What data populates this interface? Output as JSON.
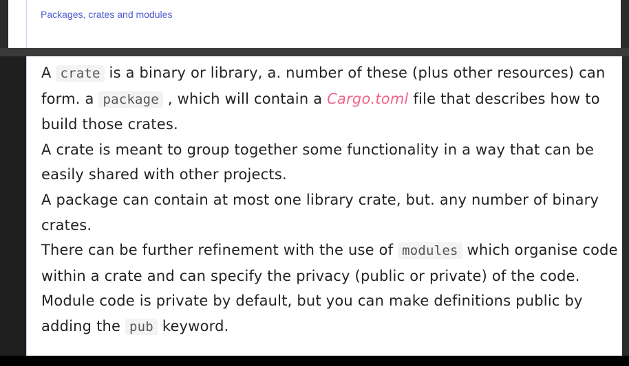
{
  "header": {
    "breadcrumb": "Packages, crates and modules"
  },
  "content": {
    "p1": {
      "t1": "A ",
      "code_crate": "crate",
      "t2": " is a binary or library, a. number of these (plus other resources) can form. a ",
      "code_package": "package",
      "t3": " , which will contain a ",
      "file_name": "Cargo.toml",
      "t4": " file that describes how to build those crates."
    },
    "p2": "A crate is meant to group together some functionality in a way that can be easily shared with other projects.",
    "p3": "A package can contain at most one library crate, but. any number of binary crates.",
    "p4": {
      "t1": "There can be further refinement with the use of ",
      "code_modules": "modules",
      "t2": " which organise code within a crate and can specify the privacy (public or private) of the code."
    },
    "p5": {
      "t1": "Module code is private by default, but you can make definitions public by adding the ",
      "code_pub": "pub",
      "t2": " keyword."
    }
  },
  "colors": {
    "breadcrumb": "#4e5bd0",
    "file_link": "#f0648a",
    "text": "#222222"
  }
}
